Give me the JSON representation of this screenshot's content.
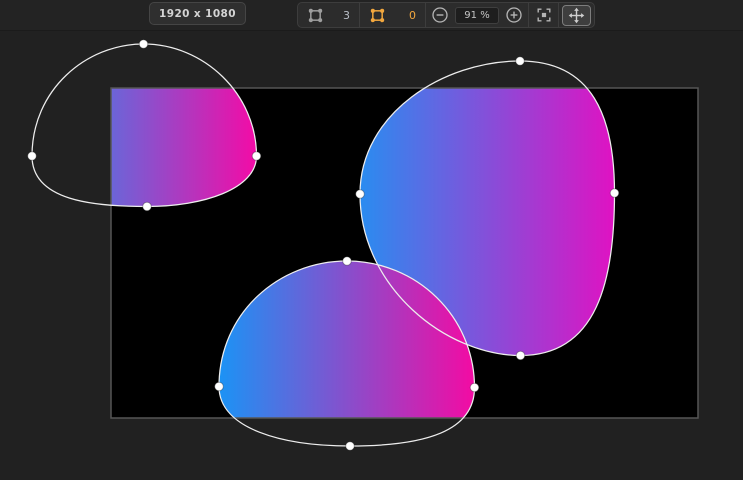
{
  "header": {
    "size_badge": "1920 x 1080"
  },
  "toolbar": {
    "shape_count": "3",
    "selected_count": "0",
    "zoom_value": "91 %",
    "icons": {
      "shapes": "bounding-box-icon",
      "selection": "bounding-box-active-icon",
      "zoom_out": "minus-circle-icon",
      "zoom_in": "plus-circle-icon",
      "fit": "fit-to-screen-icon",
      "pan": "move-tool-icon"
    }
  },
  "colors": {
    "page_bg": "#212121",
    "toolbar_bg": "#2c2c2c",
    "artboard_bg": "#000000",
    "artboard_border": "#565656",
    "path_outline": "#ededed",
    "control_point": "#ffffff",
    "accent_orange": "#f2a73e",
    "icon_gray": "#9e9e9e"
  },
  "canvas": {
    "artboard_color": "#000000",
    "outline_color": "#ededed",
    "control_point_color": "#ffffff",
    "shapes": [
      {
        "id": "blob-top-left",
        "gradient_start": "#2196f3",
        "gradient_end": "#f40ba6",
        "control_points": 4
      },
      {
        "id": "blob-top-right",
        "gradient_start": "#2a8cf0",
        "gradient_end": "#e012c2",
        "control_points": 4
      },
      {
        "id": "blob-bottom-center",
        "gradient_start": "#1b93f5",
        "gradient_end": "#f30ba3",
        "control_points": 4
      }
    ]
  }
}
